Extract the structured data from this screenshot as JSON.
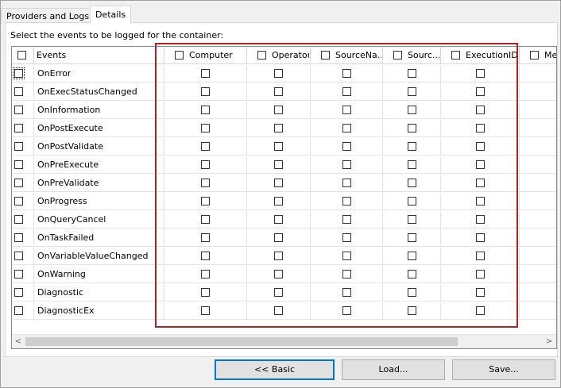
{
  "tabs": [
    {
      "label": "Providers and Logs",
      "active": false
    },
    {
      "label": "Details",
      "active": true
    }
  ],
  "instruction": "Select the events to be logged for the container:",
  "grid": {
    "events_header": "Events",
    "columns": [
      "Computer",
      "Operator",
      "SourceNa...",
      "Sourc...",
      "ExecutionID",
      "Mes"
    ],
    "events": [
      "OnError",
      "OnExecStatusChanged",
      "OnInformation",
      "OnPostExecute",
      "OnPostValidate",
      "OnPreExecute",
      "OnPreValidate",
      "OnProgress",
      "OnQueryCancel",
      "OnTaskFailed",
      "OnVariableValueChanged",
      "OnWarning",
      "Diagnostic",
      "DiagnosticEx"
    ]
  },
  "scrollbar": {
    "left_arrow": "<",
    "right_arrow": ">"
  },
  "buttons": {
    "basic": "<< Basic",
    "load": "Load...",
    "save": "Save..."
  },
  "highlight_color": "#b21f24"
}
